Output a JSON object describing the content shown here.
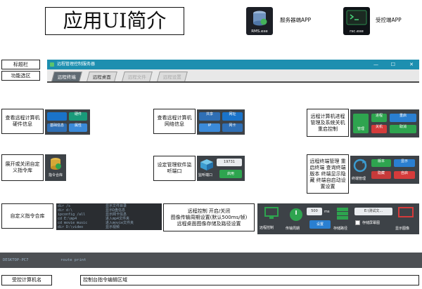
{
  "heading": "应用UI简介",
  "apps": [
    {
      "file": "RMS.exe",
      "label": "服务器端APP"
    },
    {
      "file": "rsc.exe",
      "label": "受控端APP"
    }
  ],
  "side_labels": {
    "titlebar": "标题栏",
    "tabbar": "功能选区",
    "machine_name": "受控计算机名",
    "console_area": "控制台指令编辑区域"
  },
  "window": {
    "title": "远程管理控制服务器",
    "tabs": [
      "远程终端",
      "远程桌面",
      "远程文件",
      "远程设置"
    ],
    "controls": [
      "—",
      "☐",
      "✕"
    ]
  },
  "callouts": {
    "hardware": "查看远程计算机硬件信息",
    "network": "查看远程计算机网络信息",
    "sysctl": "远程计算机进程管理及系统关机重启控制",
    "toggle_cmd": "展开或关闭自定义指令库",
    "port": "设定管理软件监听端口",
    "terminal": "远程终端管理 重启终端 查询终端版本 终端显示隐藏 终端自启动设置设置",
    "custom_lib": "自定义指令合库",
    "desktop": "远程控制 开启/关闭\n图像传输周期设置(默认500ms/帧)\n远程桌面图像存储及路径设置"
  },
  "tiles": {
    "hw": {
      "a": "硬件",
      "b": "基础信息",
      "c": "属性"
    },
    "net": {
      "a": "共享",
      "b": "网址",
      "c": "网卡",
      "d": "IP"
    },
    "proc": {
      "a": "进程",
      "b": "管理",
      "c": "关机",
      "d": "重启",
      "e": "取消"
    },
    "cmd": {
      "a": "指令合库"
    },
    "port": {
      "value": "19731",
      "label": "监听端口",
      "button": "启用"
    },
    "term": {
      "a": "终端",
      "b": "版本",
      "c": "显示",
      "d": "隐藏",
      "e": "自启",
      "f": "终端管理"
    },
    "desk": {
      "a": "远程控制",
      "b": "传输周期",
      "c": "500",
      "d": "ms",
      "e": "设置",
      "f": "存储路径",
      "g": "E:\\测试文...",
      "h": "存储屏幕图",
      "i": "显示图像"
    }
  },
  "code_lines": "dir /s\ndir d:\\\nipconfig /all\ncd E:\\mp4\ncd movie music\ndir D:\\video",
  "code_lines_right": "显示文件目录\n显示D盘信息\n显示网卡信息\n进入mp4文件夹\n进入movie文件夹\n显示视频",
  "strip": {
    "machine": "DESKTOP-PC7",
    "command": "route print"
  },
  "colors": {
    "titlebar": "#1d8fb0",
    "tile": "#3d4247",
    "accent_green": "#2ea44f",
    "accent_blue": "#1a73c9"
  }
}
